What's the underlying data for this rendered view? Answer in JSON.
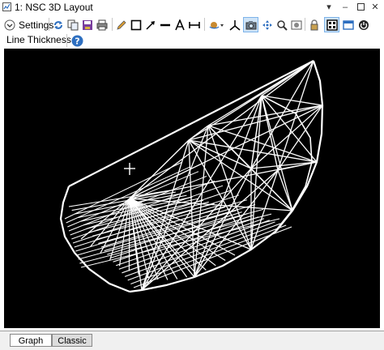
{
  "window": {
    "title": "1: NSC 3D Layout",
    "controls": [
      "dropdown-arrow-icon",
      "minimize-icon",
      "maximize-icon",
      "close-icon"
    ]
  },
  "toolbar": {
    "settings_label": "Settings",
    "line_thickness_label": "Line Thickness",
    "buttons": [
      "refresh-icon",
      "copy-icon",
      "save-icon",
      "print-icon",
      "pencil-icon",
      "rectangle-icon",
      "arrow-icon",
      "line-icon",
      "text-icon",
      "dimension-icon",
      "rotate-icon",
      "axes-icon",
      "camera-icon",
      "zoom-icon",
      "pan-icon",
      "screenshot-icon",
      "lock-icon",
      "grid-icon",
      "window-icon",
      "power-icon",
      "help-icon"
    ]
  },
  "tabs": [
    {
      "label": "Graph",
      "active": true
    },
    {
      "label": "Classic",
      "active": false
    }
  ],
  "colors": {
    "canvas_background": "#000000",
    "wireframe": "#ffffff",
    "accent": "#2e6fc0"
  }
}
